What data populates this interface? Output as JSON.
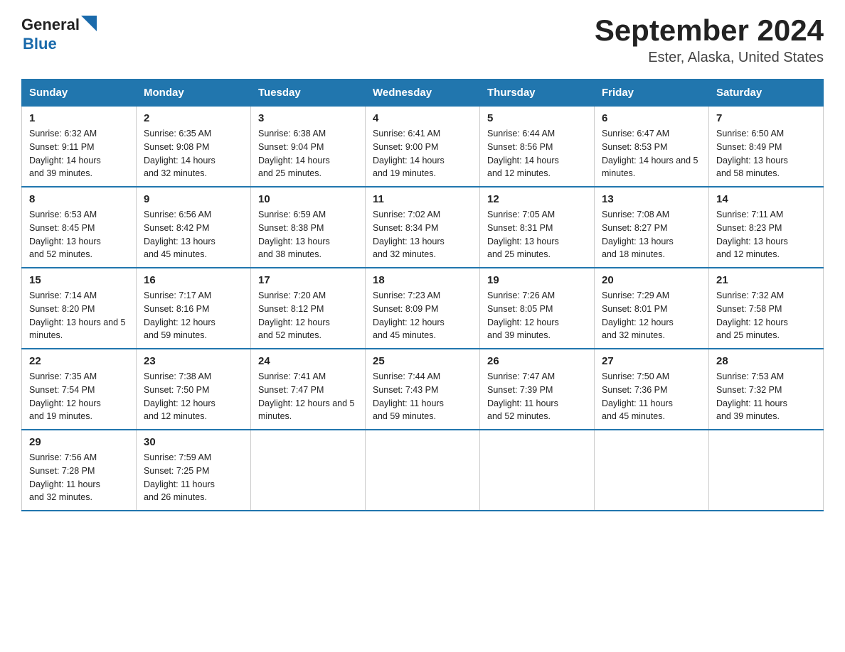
{
  "header": {
    "logo_general": "General",
    "logo_blue": "Blue",
    "title": "September 2024",
    "location": "Ester, Alaska, United States"
  },
  "days_of_week": [
    "Sunday",
    "Monday",
    "Tuesday",
    "Wednesday",
    "Thursday",
    "Friday",
    "Saturday"
  ],
  "weeks": [
    [
      {
        "day": "1",
        "sunrise": "6:32 AM",
        "sunset": "9:11 PM",
        "daylight": "14 hours and 39 minutes."
      },
      {
        "day": "2",
        "sunrise": "6:35 AM",
        "sunset": "9:08 PM",
        "daylight": "14 hours and 32 minutes."
      },
      {
        "day": "3",
        "sunrise": "6:38 AM",
        "sunset": "9:04 PM",
        "daylight": "14 hours and 25 minutes."
      },
      {
        "day": "4",
        "sunrise": "6:41 AM",
        "sunset": "9:00 PM",
        "daylight": "14 hours and 19 minutes."
      },
      {
        "day": "5",
        "sunrise": "6:44 AM",
        "sunset": "8:56 PM",
        "daylight": "14 hours and 12 minutes."
      },
      {
        "day": "6",
        "sunrise": "6:47 AM",
        "sunset": "8:53 PM",
        "daylight": "14 hours and 5 minutes."
      },
      {
        "day": "7",
        "sunrise": "6:50 AM",
        "sunset": "8:49 PM",
        "daylight": "13 hours and 58 minutes."
      }
    ],
    [
      {
        "day": "8",
        "sunrise": "6:53 AM",
        "sunset": "8:45 PM",
        "daylight": "13 hours and 52 minutes."
      },
      {
        "day": "9",
        "sunrise": "6:56 AM",
        "sunset": "8:42 PM",
        "daylight": "13 hours and 45 minutes."
      },
      {
        "day": "10",
        "sunrise": "6:59 AM",
        "sunset": "8:38 PM",
        "daylight": "13 hours and 38 minutes."
      },
      {
        "day": "11",
        "sunrise": "7:02 AM",
        "sunset": "8:34 PM",
        "daylight": "13 hours and 32 minutes."
      },
      {
        "day": "12",
        "sunrise": "7:05 AM",
        "sunset": "8:31 PM",
        "daylight": "13 hours and 25 minutes."
      },
      {
        "day": "13",
        "sunrise": "7:08 AM",
        "sunset": "8:27 PM",
        "daylight": "13 hours and 18 minutes."
      },
      {
        "day": "14",
        "sunrise": "7:11 AM",
        "sunset": "8:23 PM",
        "daylight": "13 hours and 12 minutes."
      }
    ],
    [
      {
        "day": "15",
        "sunrise": "7:14 AM",
        "sunset": "8:20 PM",
        "daylight": "13 hours and 5 minutes."
      },
      {
        "day": "16",
        "sunrise": "7:17 AM",
        "sunset": "8:16 PM",
        "daylight": "12 hours and 59 minutes."
      },
      {
        "day": "17",
        "sunrise": "7:20 AM",
        "sunset": "8:12 PM",
        "daylight": "12 hours and 52 minutes."
      },
      {
        "day": "18",
        "sunrise": "7:23 AM",
        "sunset": "8:09 PM",
        "daylight": "12 hours and 45 minutes."
      },
      {
        "day": "19",
        "sunrise": "7:26 AM",
        "sunset": "8:05 PM",
        "daylight": "12 hours and 39 minutes."
      },
      {
        "day": "20",
        "sunrise": "7:29 AM",
        "sunset": "8:01 PM",
        "daylight": "12 hours and 32 minutes."
      },
      {
        "day": "21",
        "sunrise": "7:32 AM",
        "sunset": "7:58 PM",
        "daylight": "12 hours and 25 minutes."
      }
    ],
    [
      {
        "day": "22",
        "sunrise": "7:35 AM",
        "sunset": "7:54 PM",
        "daylight": "12 hours and 19 minutes."
      },
      {
        "day": "23",
        "sunrise": "7:38 AM",
        "sunset": "7:50 PM",
        "daylight": "12 hours and 12 minutes."
      },
      {
        "day": "24",
        "sunrise": "7:41 AM",
        "sunset": "7:47 PM",
        "daylight": "12 hours and 5 minutes."
      },
      {
        "day": "25",
        "sunrise": "7:44 AM",
        "sunset": "7:43 PM",
        "daylight": "11 hours and 59 minutes."
      },
      {
        "day": "26",
        "sunrise": "7:47 AM",
        "sunset": "7:39 PM",
        "daylight": "11 hours and 52 minutes."
      },
      {
        "day": "27",
        "sunrise": "7:50 AM",
        "sunset": "7:36 PM",
        "daylight": "11 hours and 45 minutes."
      },
      {
        "day": "28",
        "sunrise": "7:53 AM",
        "sunset": "7:32 PM",
        "daylight": "11 hours and 39 minutes."
      }
    ],
    [
      {
        "day": "29",
        "sunrise": "7:56 AM",
        "sunset": "7:28 PM",
        "daylight": "11 hours and 32 minutes."
      },
      {
        "day": "30",
        "sunrise": "7:59 AM",
        "sunset": "7:25 PM",
        "daylight": "11 hours and 26 minutes."
      },
      null,
      null,
      null,
      null,
      null
    ]
  ]
}
